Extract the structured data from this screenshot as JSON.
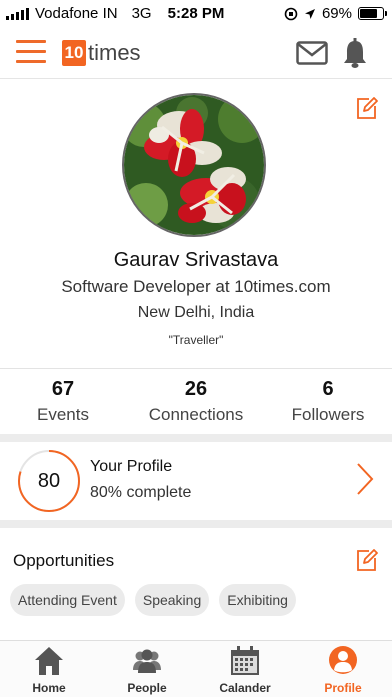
{
  "status_bar": {
    "carrier": "Vodafone IN",
    "network": "3G",
    "time": "5:28 PM",
    "battery": "69%",
    "battery_level": 0.69
  },
  "header": {
    "logo_number": "10",
    "logo_text": "times",
    "icons": [
      "menu-icon",
      "mail-icon",
      "bell-icon"
    ]
  },
  "profile": {
    "name": "Gaurav Srivastava",
    "title": "Software Developer at 10times.com",
    "location": "New Delhi, India",
    "tagline": "\"Traveller\""
  },
  "stats": [
    {
      "value": "67",
      "label": "Events"
    },
    {
      "value": "26",
      "label": "Connections"
    },
    {
      "value": "6",
      "label": "Followers"
    }
  ],
  "completion": {
    "score": "80",
    "fraction": 0.8,
    "heading": "Your Profile",
    "status": "80% complete"
  },
  "opportunities": {
    "title": "Opportunities",
    "chips": [
      "Attending Event",
      "Speaking",
      "Exhibiting"
    ]
  },
  "tabs": [
    {
      "label": "Home",
      "icon": "home-icon"
    },
    {
      "label": "People",
      "icon": "people-icon"
    },
    {
      "label": "Calander",
      "icon": "calendar-icon"
    },
    {
      "label": "Profile",
      "icon": "profile-icon",
      "active": true
    }
  ],
  "colors": {
    "accent": "#f26522",
    "chip_bg": "#ebebeb",
    "separator": "#ececec"
  }
}
